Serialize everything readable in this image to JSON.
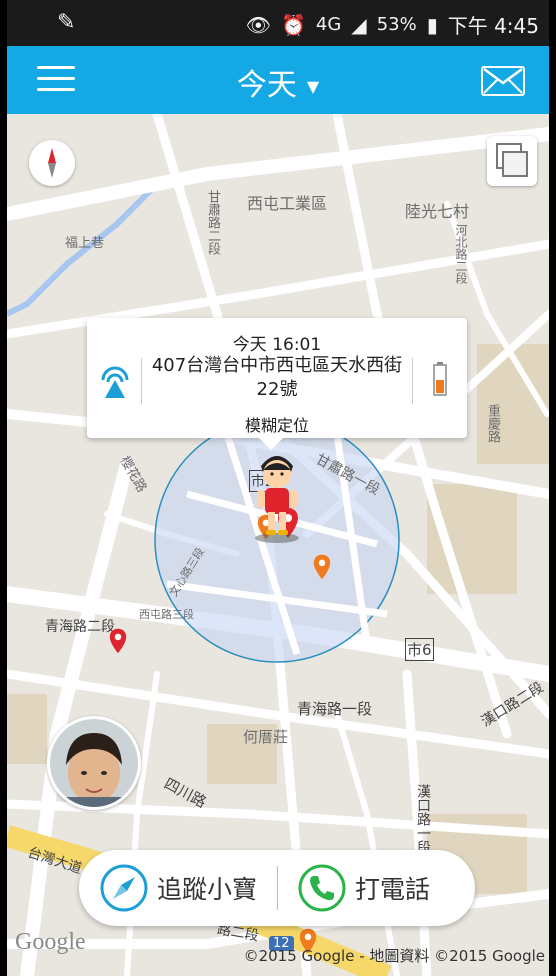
{
  "status_bar": {
    "network": "4G",
    "battery": "53%",
    "time": "下午 4:45",
    "icons": [
      "pencil-icon",
      "eye-icon",
      "alarm-icon",
      "signal-icon",
      "battery-icon"
    ]
  },
  "app_bar": {
    "title": "今天",
    "menu_icon": "hamburger-icon",
    "dropdown_icon": "caret-down-icon",
    "mail_icon": "mail-icon"
  },
  "map": {
    "labels": {
      "xitun_industrial": "西屯工業區",
      "luguang": "陸光七村",
      "fushang": "福上巷",
      "ganshu_2": "甘肅路二段",
      "hedong": "河北路二段",
      "chongde": "重慶路",
      "yinghua": "櫻花路",
      "ganshu_1": "甘肅路一段",
      "wenxin": "文心路三段",
      "xitun_3": "西屯路三段",
      "qinghai_2": "青海路二段",
      "city6": "市6",
      "qinghai_1": "青海路一段",
      "hankou_2": "漢口路二段",
      "hetang": "何厝莊",
      "sichuan": "四川路",
      "hankou_1": "漢口路一段",
      "taiwan_blvd": "台灣大道",
      "city2": "市2",
      "road2": "路二段",
      "road12": "12"
    },
    "compass_icon": "compass-icon",
    "layers_icon": "layers-icon"
  },
  "popup": {
    "time": "今天 16:01",
    "address": "407台灣台中市西屯區天水西街22號",
    "mode": "模糊定位"
  },
  "actions": {
    "track_label": "追蹤小寶",
    "call_label": "打電話"
  },
  "footer": {
    "google": "Google",
    "attribution": "©2015 Google - 地圖資料 ©2015 Google"
  },
  "colors": {
    "app_bar": "#14a9e4",
    "status_bar": "#1b1b1b",
    "accent_orange": "#f07a1c",
    "pin_red": "#e0242d",
    "phone_green": "#2bb34a",
    "circle_fill": "#c6d6f3"
  }
}
